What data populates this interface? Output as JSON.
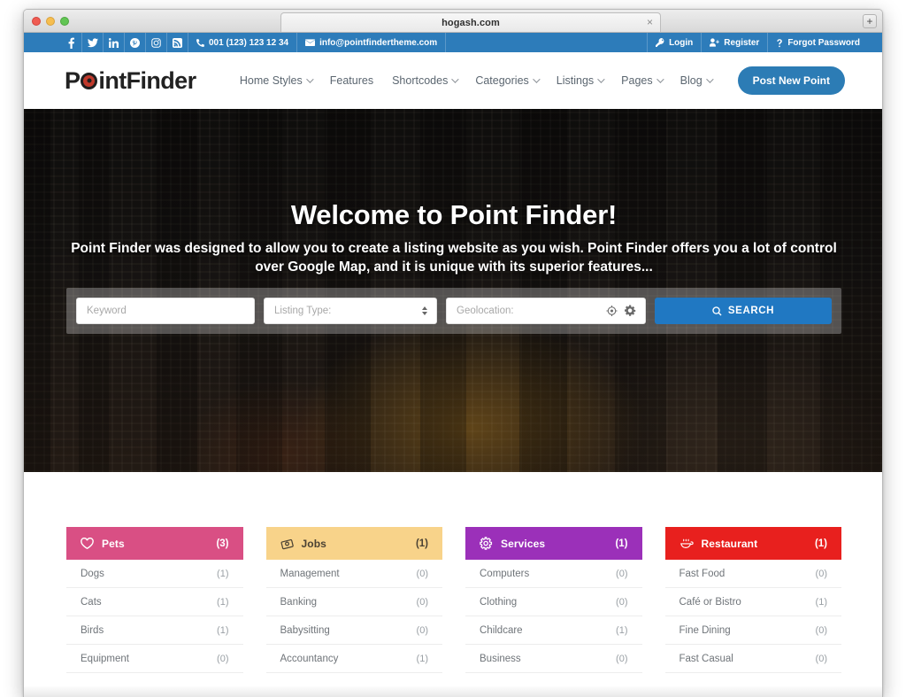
{
  "browser": {
    "tab_title": "hogash.com",
    "close_label": "×",
    "new_tab_label": "+"
  },
  "topbar": {
    "social": [
      {
        "name": "facebook-icon",
        "label": "Facebook"
      },
      {
        "name": "twitter-icon",
        "label": "Twitter"
      },
      {
        "name": "linkedin-icon",
        "label": "LinkedIn"
      },
      {
        "name": "pinterest-icon",
        "label": "Pinterest"
      },
      {
        "name": "instagram-icon",
        "label": "Instagram"
      },
      {
        "name": "rss-icon",
        "label": "RSS"
      }
    ],
    "phone": "001 (123) 123 12 34",
    "email": "info@pointfindertheme.com",
    "login": "Login",
    "register": "Register",
    "forgot_password": "Forgot Password"
  },
  "header": {
    "logo_before": "P",
    "logo_after": "intFinder",
    "nav": [
      {
        "label": "Home Styles",
        "caret": true
      },
      {
        "label": "Features",
        "caret": false
      },
      {
        "label": "Shortcodes",
        "caret": true
      },
      {
        "label": "Categories",
        "caret": true
      },
      {
        "label": "Listings",
        "caret": true
      },
      {
        "label": "Pages",
        "caret": true
      },
      {
        "label": "Blog",
        "caret": true
      }
    ],
    "cta": "Post New Point"
  },
  "hero": {
    "title": "Welcome to Point Finder!",
    "subtitle": "Point Finder was designed to allow you to create a listing website as you wish. Point Finder offers you a lot of control over Google Map, and it is unique with its superior features...",
    "search": {
      "keyword_placeholder": "Keyword",
      "listing_type_value": "Listing Type:",
      "geolocation_placeholder": "Geolocation:",
      "search_button": "SEARCH"
    }
  },
  "categories": [
    {
      "title": "Pets",
      "count": "(3)",
      "color": "#d94f84",
      "icon": "heart-icon",
      "dark_text": false,
      "items": [
        {
          "label": "Dogs",
          "count": "(1)"
        },
        {
          "label": "Cats",
          "count": "(1)"
        },
        {
          "label": "Birds",
          "count": "(1)"
        },
        {
          "label": "Equipment",
          "count": "(0)"
        }
      ]
    },
    {
      "title": "Jobs",
      "count": "(1)",
      "color": "#f8d38a",
      "icon": "tag-icon",
      "dark_text": true,
      "items": [
        {
          "label": "Management",
          "count": "(0)"
        },
        {
          "label": "Banking",
          "count": "(0)"
        },
        {
          "label": "Babysitting",
          "count": "(0)"
        },
        {
          "label": "Accountancy",
          "count": "(1)"
        }
      ]
    },
    {
      "title": "Services",
      "count": "(1)",
      "color": "#9b30b9",
      "icon": "gear-icon",
      "dark_text": false,
      "items": [
        {
          "label": "Computers",
          "count": "(0)"
        },
        {
          "label": "Clothing",
          "count": "(0)"
        },
        {
          "label": "Childcare",
          "count": "(1)"
        },
        {
          "label": "Business",
          "count": "(0)"
        }
      ]
    },
    {
      "title": "Restaurant",
      "count": "(1)",
      "color": "#e8201e",
      "icon": "food-icon",
      "dark_text": false,
      "items": [
        {
          "label": "Fast Food",
          "count": "(0)"
        },
        {
          "label": "Café or Bistro",
          "count": "(1)"
        },
        {
          "label": "Fine Dining",
          "count": "(0)"
        },
        {
          "label": "Fast Casual",
          "count": "(0)"
        }
      ]
    }
  ]
}
